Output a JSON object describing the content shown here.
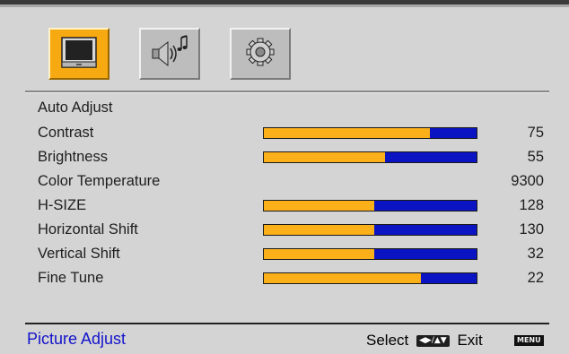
{
  "tabs": [
    {
      "name": "picture",
      "icon": "monitor-icon",
      "active": true
    },
    {
      "name": "audio",
      "icon": "speaker-music-icon",
      "active": false
    },
    {
      "name": "settings",
      "icon": "gear-icon",
      "active": false
    }
  ],
  "menu": {
    "items": [
      {
        "label": "Auto Adjust"
      },
      {
        "label": "Contrast",
        "level": 0.78,
        "value": "75"
      },
      {
        "label": "Brightness",
        "level": 0.57,
        "value": "55"
      },
      {
        "label": "Color Temperature",
        "value": "9300"
      },
      {
        "label": "H-SIZE",
        "level": 0.52,
        "value": "128"
      },
      {
        "label": "Horizontal Shift",
        "level": 0.52,
        "value": "130"
      },
      {
        "label": "Vertical Shift",
        "level": 0.52,
        "value": "32"
      },
      {
        "label": "Fine Tune",
        "level": 0.74,
        "value": "22"
      }
    ]
  },
  "footer": {
    "section_title": "Picture Adjust",
    "select_label": "Select",
    "nav_key": "◀▶/▲▼",
    "exit_label": "Exit",
    "menu_key": "MENU"
  },
  "colors": {
    "accent": "#f7a912",
    "bar_fill": "#fbb01a",
    "bar_track": "#0b14c2",
    "section_title": "#1313cc"
  }
}
